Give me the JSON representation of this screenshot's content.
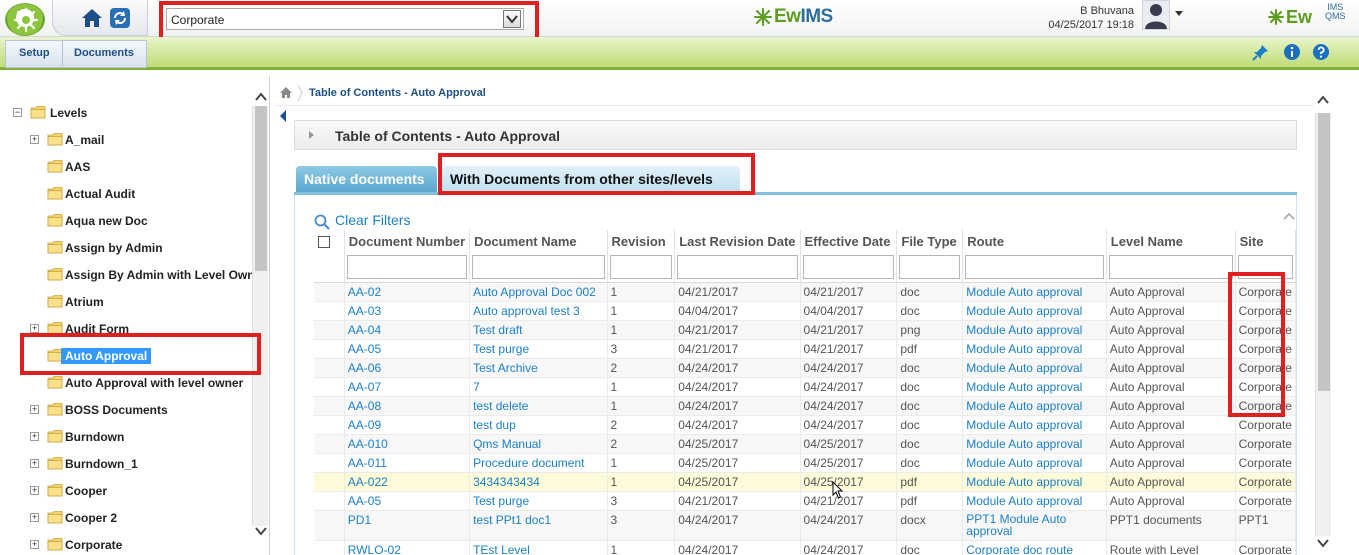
{
  "header": {
    "site_value": "Corporate",
    "brand": "EwIMS",
    "brand_prefix": "Ew",
    "brand_suffix": "IMS",
    "user_name": "B Bhuvana",
    "user_date": "04/25/2017 19:18",
    "qms_brand": "Ew",
    "qms_sup_top": "IMS",
    "qms_sup_bottom": "QMS"
  },
  "menu": {
    "setup": "Setup",
    "documents": "Documents"
  },
  "tree": {
    "root": "Levels",
    "items": [
      {
        "label": "A_mail",
        "expandable": true
      },
      {
        "label": "AAS",
        "expandable": false
      },
      {
        "label": "Actual Audit",
        "expandable": false
      },
      {
        "label": "Aqua new Doc",
        "expandable": false
      },
      {
        "label": "Assign by Admin",
        "expandable": false
      },
      {
        "label": "Assign By Admin with Level Owner",
        "expandable": false
      },
      {
        "label": "Atrium",
        "expandable": false
      },
      {
        "label": "Audit Form",
        "expandable": true
      },
      {
        "label": "Auto Approval",
        "expandable": false,
        "selected": true
      },
      {
        "label": "Auto Approval with level owner",
        "expandable": false
      },
      {
        "label": "BOSS Documents",
        "expandable": true
      },
      {
        "label": "Burndown",
        "expandable": true
      },
      {
        "label": "Burndown_1",
        "expandable": true
      },
      {
        "label": "Cooper",
        "expandable": true
      },
      {
        "label": "Cooper 2",
        "expandable": true
      },
      {
        "label": "Corporate",
        "expandable": true
      }
    ]
  },
  "content": {
    "breadcrumb": "Table of Contents - Auto Approval",
    "panel_title": "Table of Contents - Auto Approval",
    "tab_native": "Native documents",
    "tab_other": "With Documents from other sites/levels",
    "clear_filters": "Clear Filters",
    "columns": [
      "Document Number",
      "Document Name",
      "Revision",
      "Last Revision Date",
      "Effective Date",
      "File Type",
      "Route",
      "Level Name",
      "Site"
    ],
    "rows": [
      [
        "AA-02",
        "Auto Approval Doc 002",
        "1",
        "04/21/2017",
        "04/21/2017",
        "doc",
        "Module Auto approval",
        "Auto Approval",
        "Corporate"
      ],
      [
        "AA-03",
        "Auto approval test 3",
        "1",
        "04/04/2017",
        "04/04/2017",
        "doc",
        "Module Auto approval",
        "Auto Approval",
        "Corporate"
      ],
      [
        "AA-04",
        "Test draft",
        "1",
        "04/21/2017",
        "04/21/2017",
        "png",
        "Module Auto approval",
        "Auto Approval",
        "Corporate"
      ],
      [
        "AA-05",
        "Test purge",
        "3",
        "04/21/2017",
        "04/21/2017",
        "pdf",
        "Module Auto approval",
        "Auto Approval",
        "Corporate"
      ],
      [
        "AA-06",
        "Test Archive",
        "2",
        "04/24/2017",
        "04/24/2017",
        "doc",
        "Module Auto approval",
        "Auto Approval",
        "Corporate"
      ],
      [
        "AA-07",
        "7",
        "1",
        "04/24/2017",
        "04/24/2017",
        "doc",
        "Module Auto approval",
        "Auto Approval",
        "Corporate"
      ],
      [
        "AA-08",
        "test delete",
        "1",
        "04/24/2017",
        "04/24/2017",
        "doc",
        "Module Auto approval",
        "Auto Approval",
        "Corporate"
      ],
      [
        "AA-09",
        "test dup",
        "2",
        "04/24/2017",
        "04/24/2017",
        "doc",
        "Module Auto approval",
        "Auto Approval",
        "Corporate"
      ],
      [
        "AA-010",
        "Qms Manual",
        "2",
        "04/25/2017",
        "04/25/2017",
        "doc",
        "Module Auto approval",
        "Auto Approval",
        "Corporate"
      ],
      [
        "AA-011",
        "Procedure document",
        "1",
        "04/25/2017",
        "04/25/2017",
        "doc",
        "Module Auto approval",
        "Auto Approval",
        "Corporate"
      ],
      [
        "AA-022",
        "3434343434",
        "1",
        "04/25/2017",
        "04/25/2017",
        "pdf",
        "Module Auto approval",
        "Auto Approval",
        "Corporate"
      ],
      [
        "AA-05",
        "Test purge",
        "3",
        "04/21/2017",
        "04/21/2017",
        "pdf",
        "Module Auto approval",
        "Auto Approval",
        "Corporate"
      ],
      [
        "PD1",
        "test PPt1 doc1",
        "3",
        "04/24/2017",
        "04/24/2017",
        "docx",
        "PPT1 Module Auto approval",
        "PPT1 documents",
        "PPT1"
      ],
      [
        "RWLO-02",
        "TEst Level",
        "1",
        "04/24/2017",
        "04/24/2017",
        "doc",
        "Corporate doc route",
        "Route with Level",
        "Corporate"
      ]
    ],
    "highlight_row": 10
  },
  "colors": {
    "accent_green": "#7fb13a",
    "link_blue": "#1a7fc8",
    "annotation_red": "#e02020",
    "selected_blue": "#3399ff"
  }
}
